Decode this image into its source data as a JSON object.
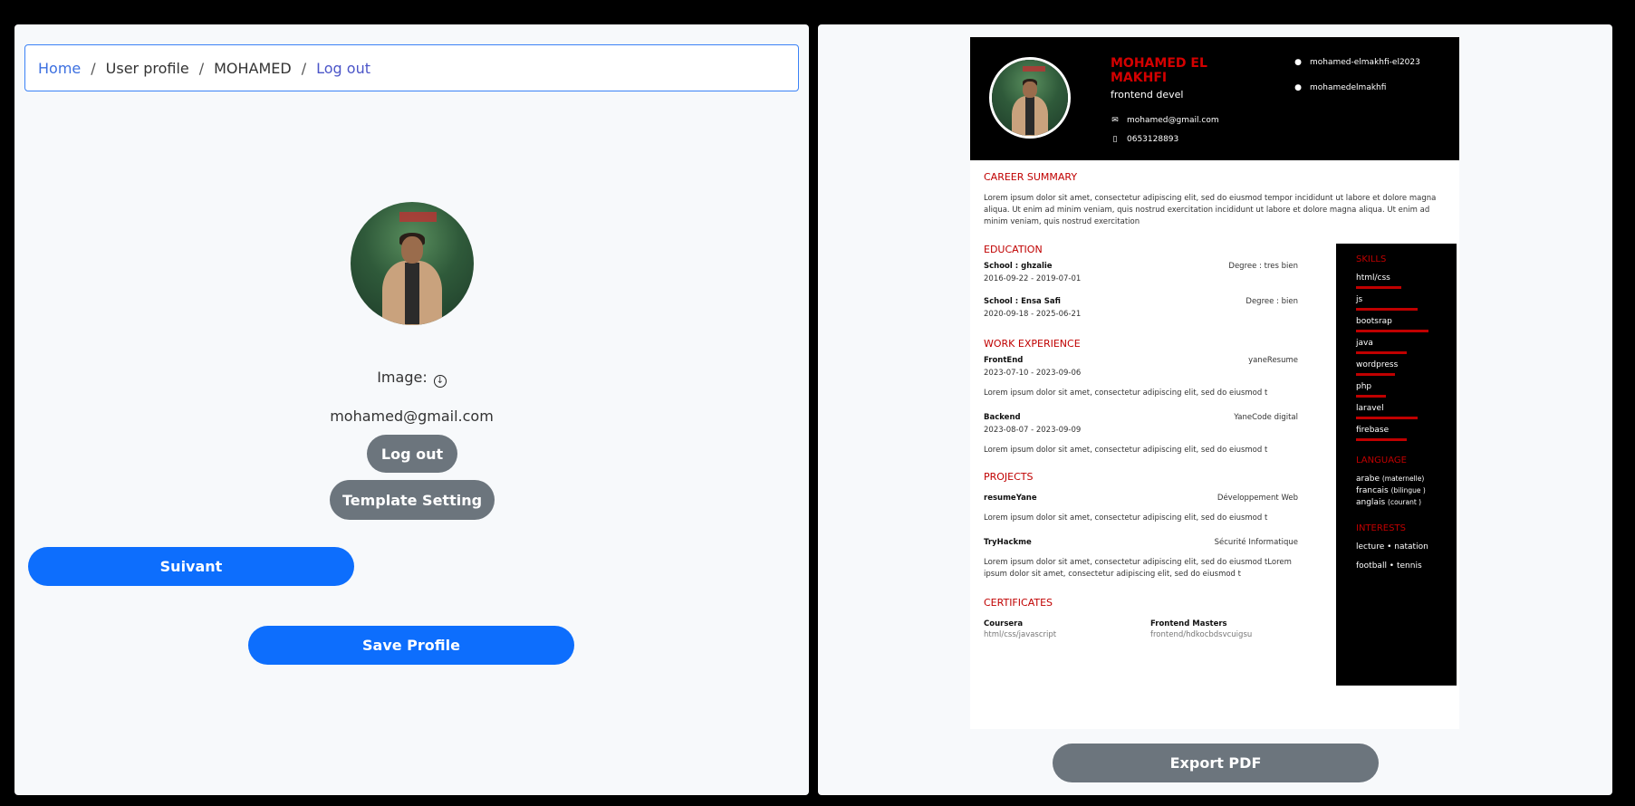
{
  "breadcrumb": {
    "home": "Home",
    "user_profile": "User profile",
    "user": "MOHAMED",
    "logout": "Log out"
  },
  "profile": {
    "image_label": "Image:",
    "email": "mohamed@gmail.com",
    "logout_label": "Log out",
    "template_setting_label": "Template Setting",
    "next_label": "Suivant",
    "save_label": "Save Profile"
  },
  "resume": {
    "name": "MOHAMED EL MAKHFI",
    "title": "frontend devel",
    "email": "mohamed@gmail.com",
    "phone": "0653128893",
    "github1": "mohamed-elmakhfi-el2023",
    "github2": "mohamedelmakhfi",
    "career_title": "CAREER SUMMARY",
    "career_text": "Lorem ipsum dolor sit amet, consectetur adipiscing elit, sed do eiusmod tempor incididunt ut labore et dolore magna aliqua. Ut enim ad minim veniam, quis nostrud exercitation incididunt ut labore et dolore magna aliqua. Ut enim ad minim veniam, quis nostrud exercitation",
    "education_title": "EDUCATION",
    "education": [
      {
        "school": "School : ghzalie",
        "dates": "2016-09-22 - 2019-07-01",
        "degree": "Degree : tres bien"
      },
      {
        "school": "School : Ensa Safi",
        "dates": "2020-09-18 - 2025-06-21",
        "degree": "Degree : bien"
      }
    ],
    "work_title": "WORK EXPERIENCE",
    "work": [
      {
        "role": "FrontEnd",
        "dates": "2023-07-10 - 2023-09-06",
        "company": "yaneResume",
        "desc": "Lorem ipsum dolor sit amet, consectetur adipiscing elit, sed do eiusmod t"
      },
      {
        "role": "Backend",
        "dates": "2023-08-07 - 2023-09-09",
        "company": "YaneCode digital",
        "desc": "Lorem ipsum dolor sit amet, consectetur adipiscing elit, sed do eiusmod t"
      }
    ],
    "projects_title": "PROJECTS",
    "projects": [
      {
        "name": "resumeYane",
        "type": "Développement Web",
        "desc": "Lorem ipsum dolor sit amet, consectetur adipiscing elit, sed do eiusmod t"
      },
      {
        "name": "TryHackme",
        "type": "Sécurité Informatique",
        "desc": "Lorem ipsum dolor sit amet, consectetur adipiscing elit, sed do eiusmod tLorem ipsum dolor sit amet, consectetur adipiscing elit, sed do eiusmod t"
      }
    ],
    "certificates_title": "CERTIFICATES",
    "certificates": [
      {
        "name": "Coursera",
        "detail": "html/css/javascript"
      },
      {
        "name": "Frontend Masters",
        "detail": "frontend/hdkocbdsvcuigsu"
      }
    ],
    "skills_title": "SKILLS",
    "skills": [
      {
        "name": "html/css",
        "level": 0.43
      },
      {
        "name": "js",
        "level": 0.58
      },
      {
        "name": "bootsrap",
        "level": 0.68
      },
      {
        "name": "java",
        "level": 0.48
      },
      {
        "name": "wordpress",
        "level": 0.37
      },
      {
        "name": "php",
        "level": 0.28
      },
      {
        "name": "laravel",
        "level": 0.58
      },
      {
        "name": "firebase",
        "level": 0.48
      }
    ],
    "language_title": "LANGUAGE",
    "languages": [
      {
        "name": "arabe",
        "level": "(maternelle)"
      },
      {
        "name": "francais",
        "level": "(bilingue )"
      },
      {
        "name": "anglais",
        "level": "(courant )"
      }
    ],
    "interests_title": "INTERESTS",
    "interests": [
      "lecture • natation",
      "football • tennis"
    ],
    "export_label": "Export PDF"
  },
  "colors": {
    "accent_blue": "#0d6efd",
    "gray_button": "#6c757d",
    "resume_red": "#c00000"
  }
}
